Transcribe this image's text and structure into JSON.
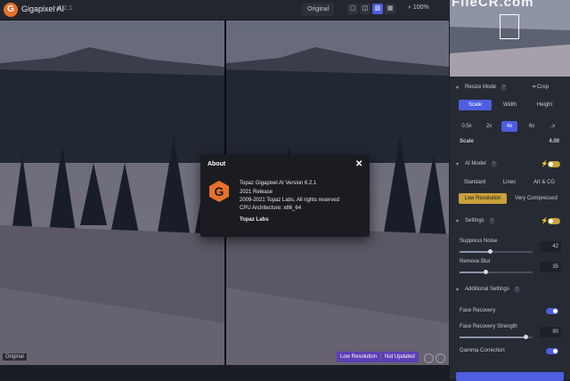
{
  "app": {
    "title": "Gigapixel AI",
    "version": "v6.2.1",
    "logo": "G"
  },
  "toolbar": {
    "original_label": "Original",
    "zoom": "100%",
    "view_icons": [
      "single-view-icon",
      "side-by-side-icon",
      "split-view-icon",
      "quad-view-icon"
    ]
  },
  "watermark": "FileCR.com",
  "preview": {
    "original_label": "Original",
    "status_low_res": "Low Resolution",
    "status_not_updated": "Not Updated"
  },
  "about": {
    "title": "About",
    "close": "✕",
    "lines": [
      "Topaz Gigapixel AI Version 6.2.1",
      "2021 Release",
      "2009-2021 Topaz Labs, All rights reserved",
      "CPU Architecture: x86_64"
    ],
    "link": "Topaz Labs"
  },
  "sidebar": {
    "resize_mode": {
      "title": "Resize Mode",
      "crop_label": "Crop",
      "tabs": [
        "Scale",
        "Width",
        "Height"
      ],
      "active_tab": 0
    },
    "scale_options": [
      "0.5x",
      "2x",
      "4x",
      "6x",
      "..x"
    ],
    "active_scale": 2,
    "scale": {
      "label": "Scale",
      "value": "4.00"
    },
    "ai_model": {
      "title": "AI Model",
      "models": [
        "Standard",
        "Lines",
        "Art & CG"
      ],
      "types": [
        "Low Resolution",
        "Very Compressed"
      ],
      "active_type": 0
    },
    "settings": {
      "title": "Settings",
      "suppress_noise": {
        "label": "Suppress Noise",
        "value": "42",
        "level": 0.42
      },
      "remove_blur": {
        "label": "Remove Blur",
        "value": "35",
        "level": 0.35
      }
    },
    "additional": {
      "title": "Additional Settings",
      "face_recovery": {
        "label": "Face Recovery",
        "on": true
      },
      "face_strength": {
        "label": "Face Recovery Strength",
        "value": "90",
        "level": 0.9
      },
      "gamma": {
        "label": "Gamma Correction",
        "on": true
      }
    }
  },
  "colors": {
    "accent": "#4d5ee0",
    "gold": "#c9a13a",
    "logo": "#e8702a",
    "status": "#5d3fb5"
  }
}
